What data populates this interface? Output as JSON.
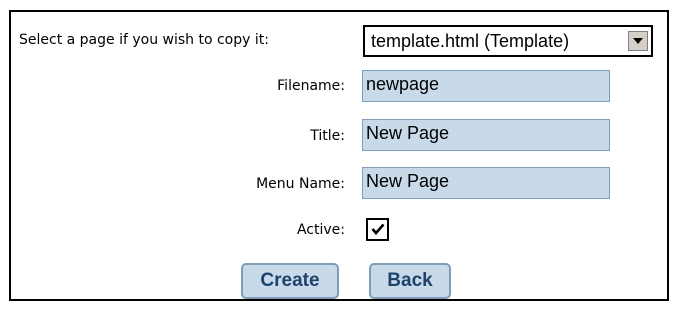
{
  "form": {
    "copy_label": "Select a page if you wish to copy it:",
    "copy_select_value": "template.html (Template)",
    "filename_label": "Filename:",
    "filename_value": "newpage",
    "title_label": "Title:",
    "title_value": "New Page",
    "menu_name_label": "Menu Name:",
    "menu_name_value": "New Page",
    "active_label": "Active:",
    "active_checked": true
  },
  "buttons": {
    "create_label": "Create",
    "back_label": "Back"
  },
  "icons": {
    "dropdown": "chevron-down-icon",
    "check": "checkmark-icon"
  },
  "colors": {
    "field_bg": "#c8daea",
    "button_text": "#20436b"
  }
}
